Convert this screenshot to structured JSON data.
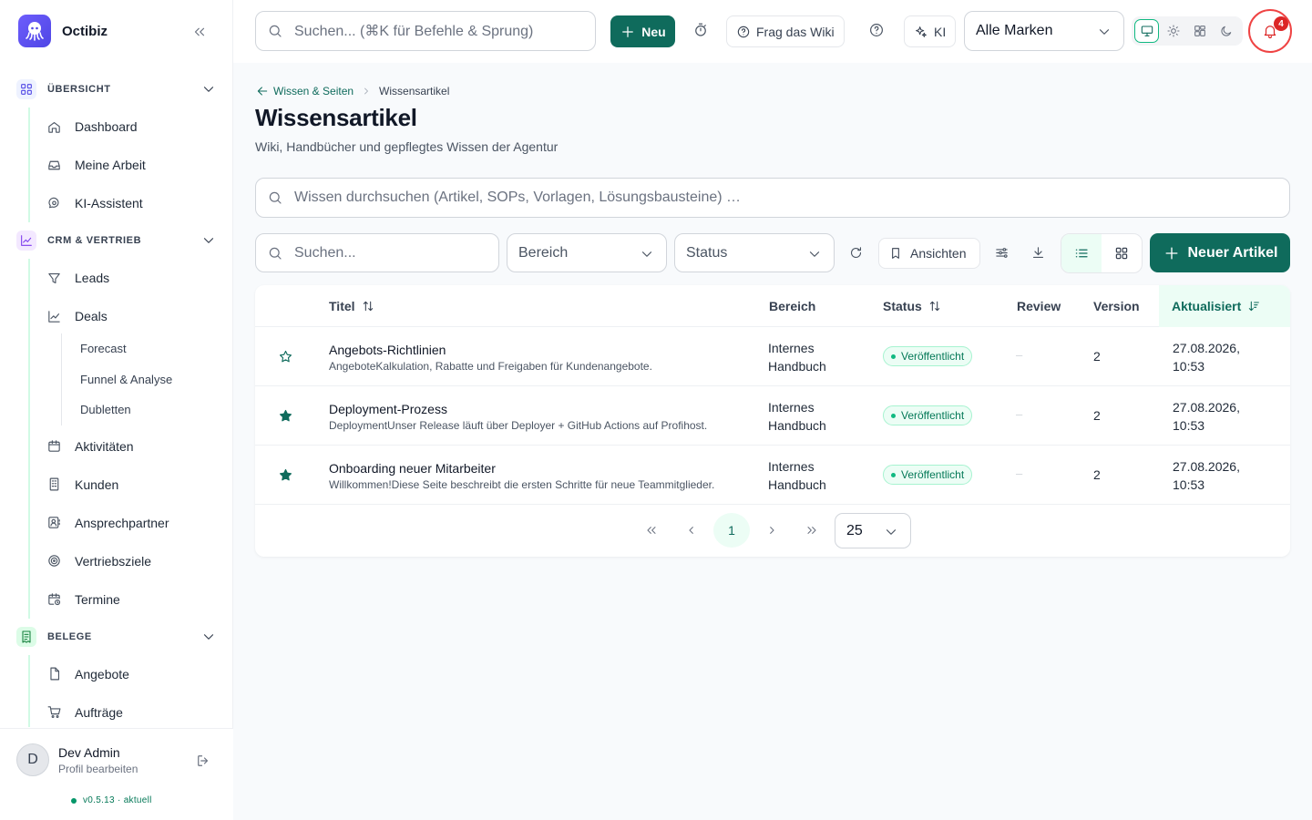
{
  "app": {
    "name": "Octibiz"
  },
  "sidebar": {
    "sections": [
      {
        "label": "ÜBERSICHT",
        "items": [
          {
            "label": "Dashboard",
            "icon": "home-icon"
          },
          {
            "label": "Meine Arbeit",
            "icon": "inbox-icon"
          },
          {
            "label": "KI-Assistent",
            "icon": "chat-search-icon"
          }
        ]
      },
      {
        "label": "CRM & VERTRIEB",
        "items": [
          {
            "label": "Leads",
            "icon": "funnel-icon"
          },
          {
            "label": "Deals",
            "icon": "chart-line-icon",
            "children": [
              "Forecast",
              "Funnel & Analyse",
              "Dubletten"
            ]
          },
          {
            "label": "Aktivitäten",
            "icon": "calendar-icon"
          },
          {
            "label": "Kunden",
            "icon": "building-icon"
          },
          {
            "label": "Ansprechpartner",
            "icon": "contact-icon"
          },
          {
            "label": "Vertriebsziele",
            "icon": "target-icon"
          },
          {
            "label": "Termine",
            "icon": "calendar-clock-icon"
          }
        ]
      },
      {
        "label": "BELEGE",
        "items": [
          {
            "label": "Angebote",
            "icon": "file-icon"
          },
          {
            "label": "Aufträge",
            "icon": "cart-icon"
          }
        ]
      }
    ],
    "user": {
      "name": "Dev Admin",
      "initial": "D",
      "subtitle": "Profil bearbeiten"
    },
    "version": {
      "text": "v0.5.13 · aktuell"
    }
  },
  "topbar": {
    "search_placeholder": "Suchen... (⌘K für Befehle & Sprung)",
    "new_label": "Neu",
    "wiki_label": "Frag das Wiki",
    "ai_label": "KI",
    "brand_select": "Alle Marken",
    "notifications_count": "4"
  },
  "page": {
    "breadcrumb": {
      "parent": "Wissen & Seiten",
      "current": "Wissensartikel"
    },
    "title": "Wissensartikel",
    "subtitle": "Wiki, Handbücher und gepflegtes Wissen der Agentur",
    "knowledge_search_placeholder": "Wissen durchsuchen (Artikel, SOPs, Vorlagen, Lösungsbausteine) …",
    "filters": {
      "search_placeholder": "Suchen...",
      "area_label": "Bereich",
      "status_label": "Status",
      "views_label": "Ansichten",
      "new_article_label": "Neuer Artikel"
    }
  },
  "table": {
    "columns": {
      "title": "Titel",
      "area": "Bereich",
      "status": "Status",
      "review": "Review",
      "version": "Version",
      "updated": "Aktualisiert"
    },
    "rows": [
      {
        "starred": false,
        "title": "Angebots-Richtlinien",
        "description": "AngeboteKalkulation, Rabatte und Freigaben für Kundenangebote.",
        "area": "Internes Handbuch",
        "status": "Veröffentlicht",
        "review": "–",
        "version": "2",
        "updated": "27.08.2026, 10:53"
      },
      {
        "starred": true,
        "title": "Deployment-Prozess",
        "description": "DeploymentUnser Release läuft über Deployer + GitHub Actions auf Profihost.",
        "area": "Internes Handbuch",
        "status": "Veröffentlicht",
        "review": "–",
        "version": "2",
        "updated": "27.08.2026, 10:53"
      },
      {
        "starred": true,
        "title": "Onboarding neuer Mitarbeiter",
        "description": "Willkommen!Diese Seite beschreibt die ersten Schritte für neue Teammitglieder.",
        "area": "Internes Handbuch",
        "status": "Veröffentlicht",
        "review": "–",
        "version": "2",
        "updated": "27.08.2026, 10:53"
      }
    ],
    "pagination": {
      "current_page": "1",
      "page_size": "25"
    }
  },
  "colors": {
    "accent": "#0f6b5c",
    "brand": "#5b4cf0",
    "status_ok": "#047857",
    "danger": "#dc2626"
  }
}
